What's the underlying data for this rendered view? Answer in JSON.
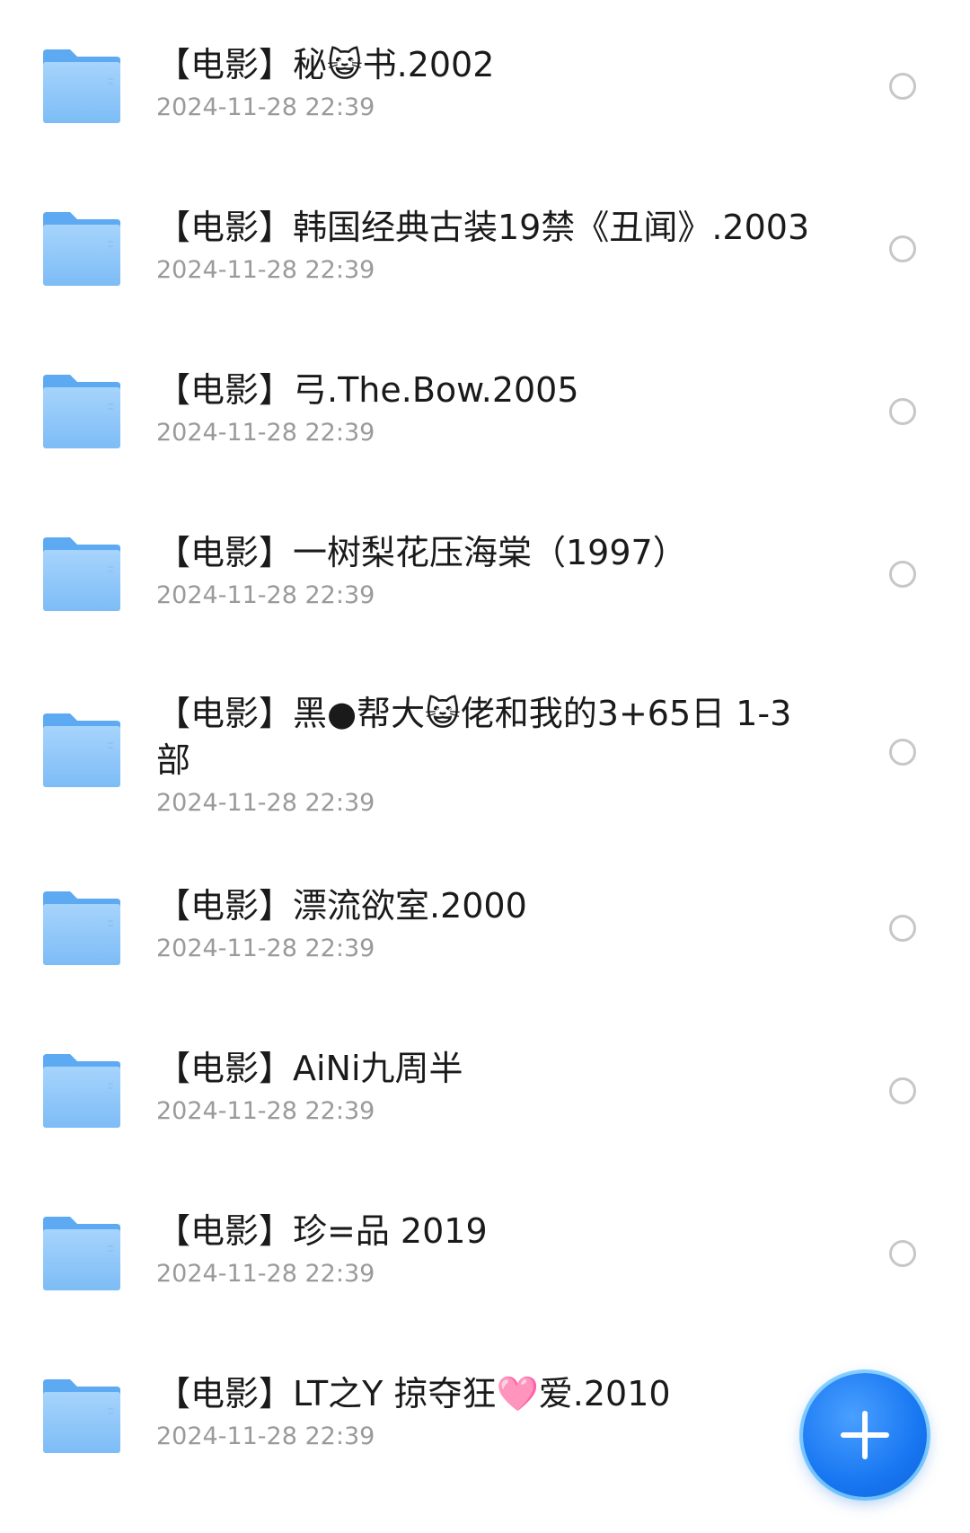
{
  "files": [
    {
      "title": "【电影】秘😺书.2002",
      "date": "2024-11-28 22:39"
    },
    {
      "title": "【电影】韩国经典古装19禁《丑闻》.2003",
      "date": "2024-11-28 22:39"
    },
    {
      "title": "【电影】弓.The.Bow.2005",
      "date": "2024-11-28 22:39"
    },
    {
      "title": "【电影】一树梨花压海棠（1997）",
      "date": "2024-11-28 22:39"
    },
    {
      "title": "【电影】黑●帮大😺佬和我的3+65日 1-3部",
      "date": "2024-11-28 22:39"
    },
    {
      "title": "【电影】漂流欲室.2000",
      "date": "2024-11-28 22:39"
    },
    {
      "title": "【电影】AiNi九周半",
      "date": "2024-11-28 22:39"
    },
    {
      "title": "【电影】珍=品 2019",
      "date": "2024-11-28 22:39"
    },
    {
      "title": "【电影】LT之Y 掠夺狂🩷爱.2010",
      "date": "2024-11-28 22:39"
    }
  ],
  "icons": {
    "folder": "folder-icon",
    "select": "radio-unchecked-icon",
    "add": "plus-icon"
  },
  "colors": {
    "folder_light": "#9fd0fb",
    "folder_dark": "#5daaf3",
    "fab": "#1877f2",
    "date_text": "#9a9a9a",
    "title_text": "#1a1a1a"
  }
}
